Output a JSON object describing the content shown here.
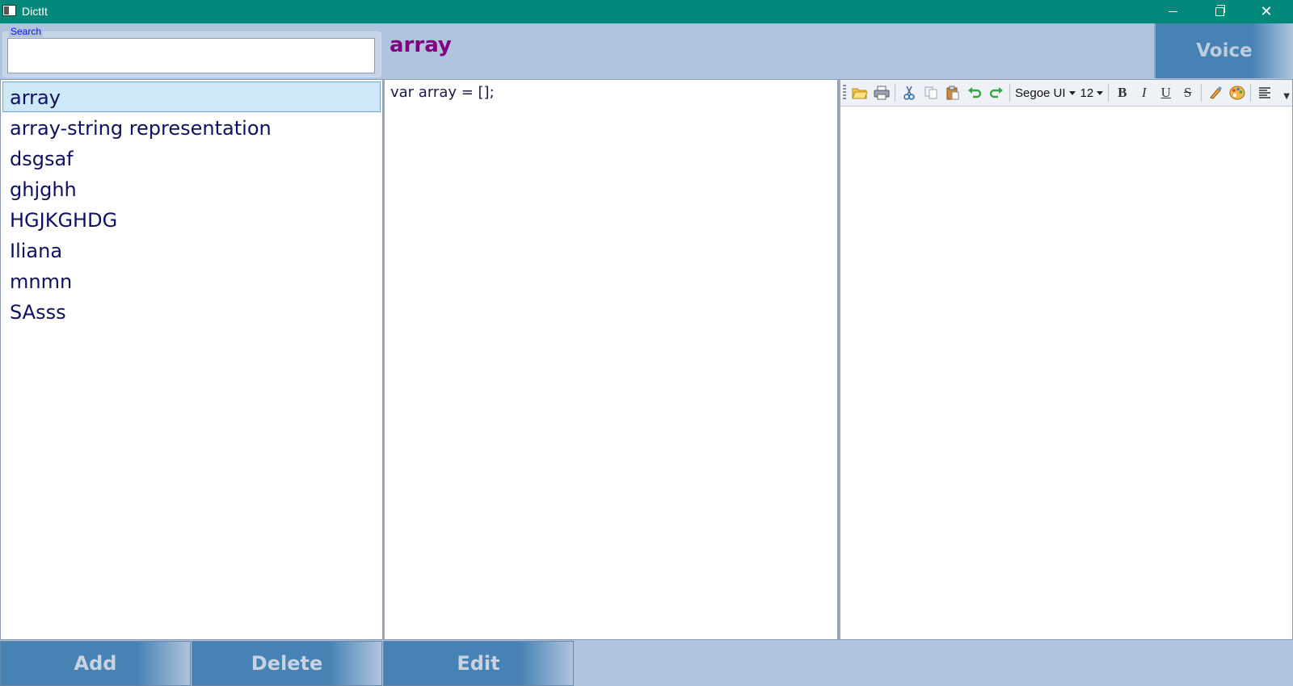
{
  "window": {
    "title": "DictIt",
    "icons": {
      "app": "app-icon",
      "minimize": "minimize-icon",
      "maximize": "restore-icon",
      "close": "close-icon"
    }
  },
  "search": {
    "label": "Search",
    "value": "",
    "placeholder": ""
  },
  "entry": {
    "title": "array",
    "content": "var array = [];"
  },
  "voice_button": {
    "label": "Voice"
  },
  "words": [
    {
      "label": "array",
      "selected": true
    },
    {
      "label": "array-string representation",
      "selected": false
    },
    {
      "label": "dsgsaf",
      "selected": false
    },
    {
      "label": "ghjghh",
      "selected": false
    },
    {
      "label": "HGJKGHDG",
      "selected": false
    },
    {
      "label": "Iliana",
      "selected": false
    },
    {
      "label": "mnmn",
      "selected": false
    },
    {
      "label": "SAsss",
      "selected": false
    }
  ],
  "toolbar": {
    "font": "Segoe UI",
    "size": "12",
    "bold": "B",
    "italic": "I",
    "underline": "U",
    "strike": "S",
    "icons": [
      "open-icon",
      "print-icon",
      "cut-icon",
      "copy-icon",
      "paste-icon",
      "undo-icon",
      "redo-icon",
      "highlight-icon",
      "color-palette-icon",
      "align-icon",
      "overflow-icon"
    ]
  },
  "buttons": {
    "add": "Add",
    "delete": "Delete",
    "edit": "Edit"
  },
  "colors": {
    "titlebar": "#00897b",
    "background": "#b0c4de",
    "button": "#4682b4",
    "heading": "#800080",
    "list_text": "#101060",
    "selection": "#cde8f7"
  }
}
